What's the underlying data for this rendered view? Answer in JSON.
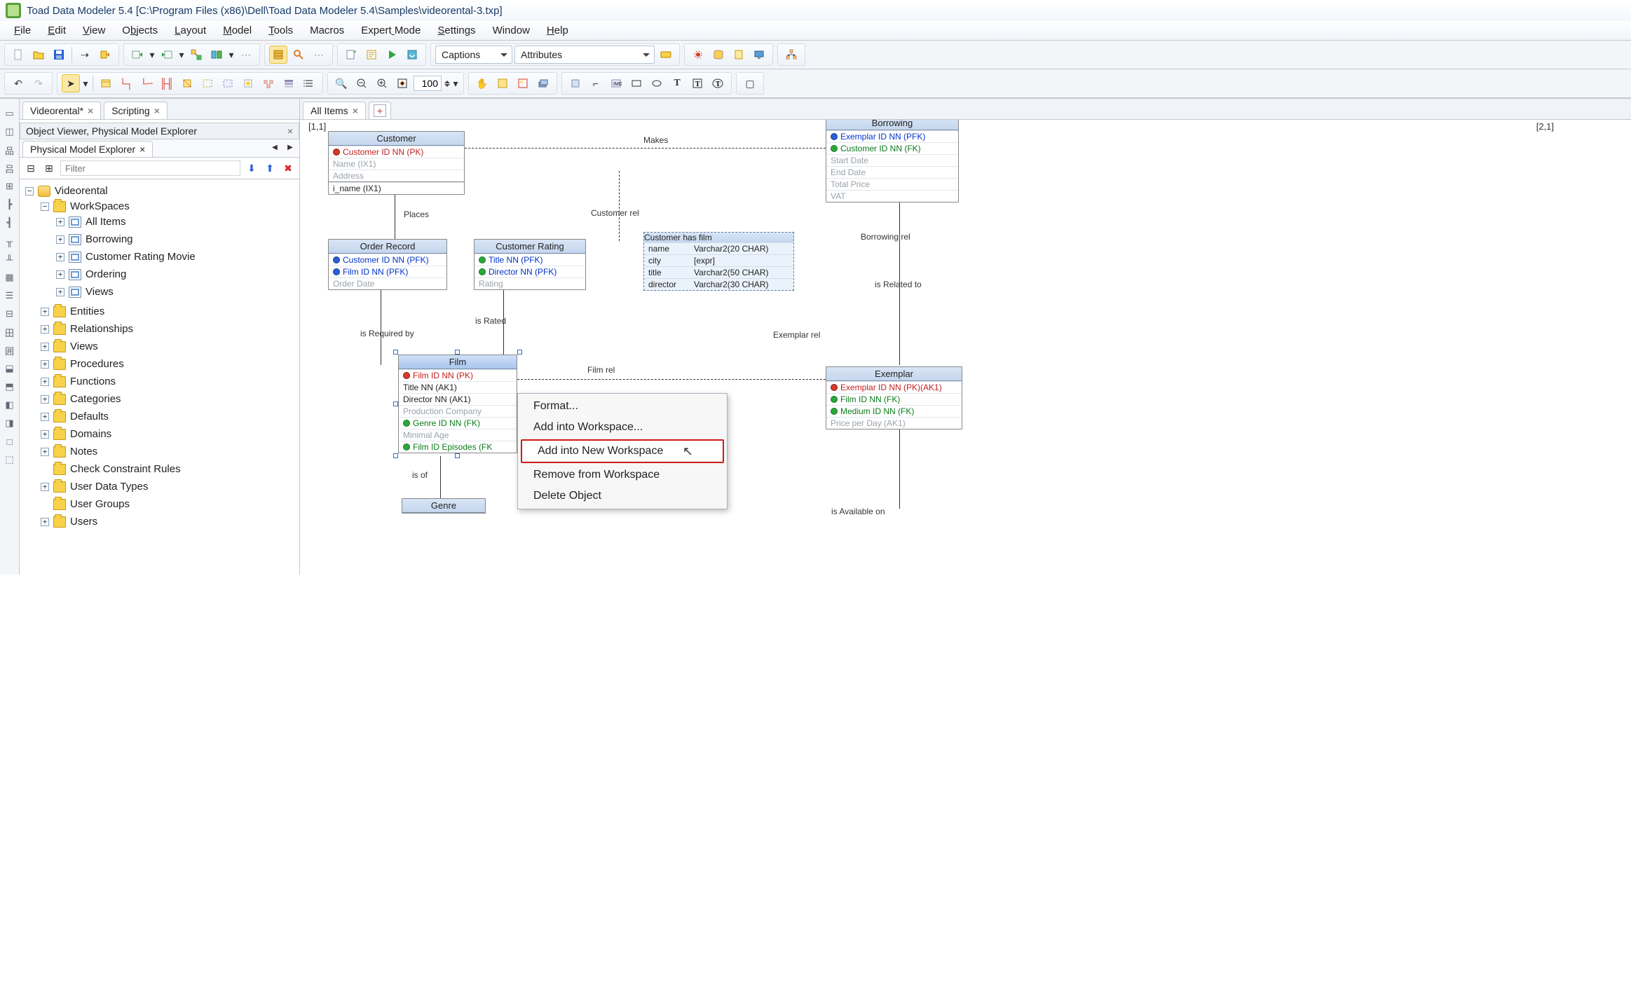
{
  "app": {
    "title": "Toad Data Modeler 5.4  [C:\\Program Files (x86)\\Dell\\Toad Data Modeler 5.4\\Samples\\videorental-3.txp]",
    "icon": "frog-icon"
  },
  "menu": [
    "File",
    "Edit",
    "View",
    "Objects",
    "Layout",
    "Model",
    "Tools",
    "Macros",
    "Expert Mode",
    "Settings",
    "Window",
    "Help"
  ],
  "menu_underline_idx": [
    0,
    0,
    0,
    1,
    0,
    0,
    0,
    -1,
    6,
    0,
    -1,
    0
  ],
  "dropdowns": {
    "captions": "Captions",
    "attributes": "Attributes"
  },
  "zoom": "100",
  "doc_tabs": [
    {
      "label": "Videorental*"
    },
    {
      "label": "Scripting"
    }
  ],
  "left_panels": {
    "header": "Object Viewer, Physical Model Explorer",
    "sub": "Physical Model Explorer",
    "filter_placeholder": "Filter"
  },
  "tree": {
    "root": "Videorental",
    "workspaces_label": "WorkSpaces",
    "workspaces": [
      "All Items",
      "Borrowing",
      "Customer Rating Movie",
      "Ordering",
      "Views"
    ],
    "folders": [
      "Entities",
      "Relationships",
      "Views",
      "Procedures",
      "Functions",
      "Categories",
      "Defaults",
      "Domains",
      "Notes",
      "Check Constraint Rules",
      "User Data Types",
      "User Groups",
      "Users"
    ]
  },
  "canvas_tabs": {
    "active": "All Items"
  },
  "coords": {
    "tl": "[1,1]",
    "tr": "[2,1]"
  },
  "entities": {
    "customer": {
      "title": "Customer",
      "rows": [
        {
          "txt": "Customer ID NN  (PK)",
          "cls": "pk",
          "icon": "red"
        },
        {
          "txt": "Name  (IX1)",
          "cls": "dim"
        },
        {
          "txt": "Address",
          "cls": "dim"
        }
      ],
      "footer": "i_name (IX1)"
    },
    "order_record": {
      "title": "Order Record",
      "rows": [
        {
          "txt": "Customer ID NN  (PFK)",
          "cls": "pfk",
          "icon": "blue"
        },
        {
          "txt": "Film ID NN  (PFK)",
          "cls": "pfk",
          "icon": "blue"
        },
        {
          "txt": "Order Date",
          "cls": "dim"
        }
      ]
    },
    "customer_rating": {
      "title": "Customer Rating",
      "rows": [
        {
          "txt": "Title NN  (PFK)",
          "cls": "pfk",
          "icon": "green"
        },
        {
          "txt": "Director NN  (PFK)",
          "cls": "pfk",
          "icon": "green"
        },
        {
          "txt": "Rating",
          "cls": "dim"
        }
      ]
    },
    "film": {
      "title": "Film",
      "rows": [
        {
          "txt": "Film ID NN  (PK)",
          "cls": "pk",
          "icon": "red"
        },
        {
          "txt": "Title NN (AK1)"
        },
        {
          "txt": "Director NN (AK1)"
        },
        {
          "txt": "Production Company",
          "cls": "dim"
        },
        {
          "txt": "Genre ID NN  (FK)",
          "cls": "fk",
          "icon": "green"
        },
        {
          "txt": "Minimal Age",
          "cls": "dim"
        },
        {
          "txt": "Film ID Episodes   (FK",
          "cls": "fk",
          "icon": "green"
        }
      ]
    },
    "borrowing": {
      "title": "Borrowing",
      "rows": [
        {
          "txt": "Exemplar ID NN  (PFK)",
          "cls": "pfk",
          "icon": "blue"
        },
        {
          "txt": "Customer ID NN  (FK)",
          "cls": "fk",
          "icon": "green"
        },
        {
          "txt": "Start Date",
          "cls": "dim"
        },
        {
          "txt": "End Date",
          "cls": "dim"
        },
        {
          "txt": "Total Price",
          "cls": "dim"
        },
        {
          "txt": "VAT",
          "cls": "dim"
        }
      ]
    },
    "exemplar": {
      "title": "Exemplar",
      "rows": [
        {
          "txt": "Exemplar ID NN  (PK)(AK1)",
          "cls": "pk",
          "icon": "red"
        },
        {
          "txt": "Film ID NN  (FK)",
          "cls": "fk",
          "icon": "green"
        },
        {
          "txt": "Medium ID NN  (FK)",
          "cls": "fk",
          "icon": "green"
        },
        {
          "txt": "Price per Day  (AK1)",
          "cls": "dim"
        }
      ]
    },
    "genre": {
      "title": "Genre"
    }
  },
  "view_customer_has_film": {
    "title": "Customer has film",
    "rows": [
      [
        "name",
        "Varchar2(20 CHAR)"
      ],
      [
        "city",
        "[expr]"
      ],
      [
        "title",
        "Varchar2(50 CHAR)"
      ],
      [
        "director",
        "Varchar2(30 CHAR)"
      ]
    ]
  },
  "rel_labels": {
    "makes": "Makes",
    "places": "Places",
    "customer_rel": "Customer rel",
    "is_required_by": "is Required by",
    "is_rated": "is Rated",
    "film_rel": "Film rel",
    "borrowing_rel": "Borrowing rel",
    "is_related_to": "is Related to",
    "exemplar_rel": "Exemplar rel",
    "is_of": "is of",
    "is_available_on": "is Available on"
  },
  "context_menu": [
    "Format...",
    "Add into Workspace...",
    "Add into New Workspace",
    "Remove from Workspace",
    "Delete Object"
  ],
  "context_highlight_index": 2
}
